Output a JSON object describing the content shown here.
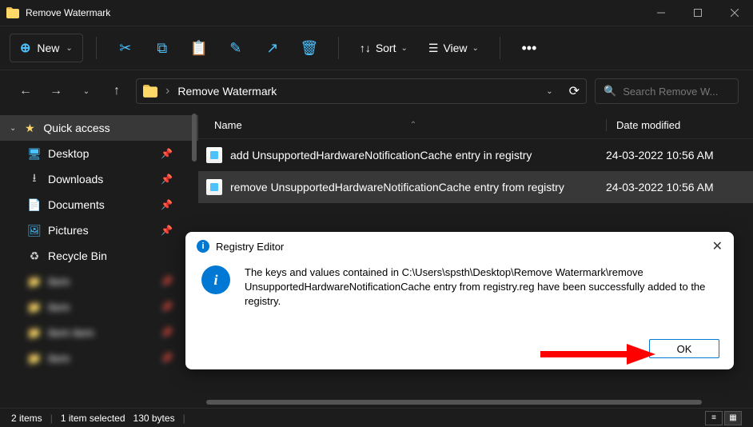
{
  "titlebar": {
    "title": "Remove Watermark"
  },
  "toolbar": {
    "new_label": "New",
    "sort_label": "Sort",
    "view_label": "View"
  },
  "breadcrumb": {
    "path": "Remove Watermark"
  },
  "search": {
    "placeholder": "Search Remove W..."
  },
  "sidebar": {
    "quick_access": "Quick access",
    "items": [
      {
        "label": "Desktop"
      },
      {
        "label": "Downloads"
      },
      {
        "label": "Documents"
      },
      {
        "label": "Pictures"
      },
      {
        "label": "Recycle Bin"
      }
    ]
  },
  "columns": {
    "name": "Name",
    "date": "Date modified"
  },
  "files": [
    {
      "name": "add UnsupportedHardwareNotificationCache entry in registry",
      "date": "24-03-2022 10:56 AM",
      "selected": false
    },
    {
      "name": "remove UnsupportedHardwareNotificationCache entry from registry",
      "date": "24-03-2022 10:56 AM",
      "selected": true
    }
  ],
  "statusbar": {
    "items": "2 items",
    "selected": "1 item selected",
    "size": "130 bytes"
  },
  "dialog": {
    "title": "Registry Editor",
    "message": "The keys and values contained in C:\\Users\\spsth\\Desktop\\Remove Watermark\\remove UnsupportedHardwareNotificationCache entry from registry.reg have been successfully added to the registry.",
    "ok": "OK"
  }
}
